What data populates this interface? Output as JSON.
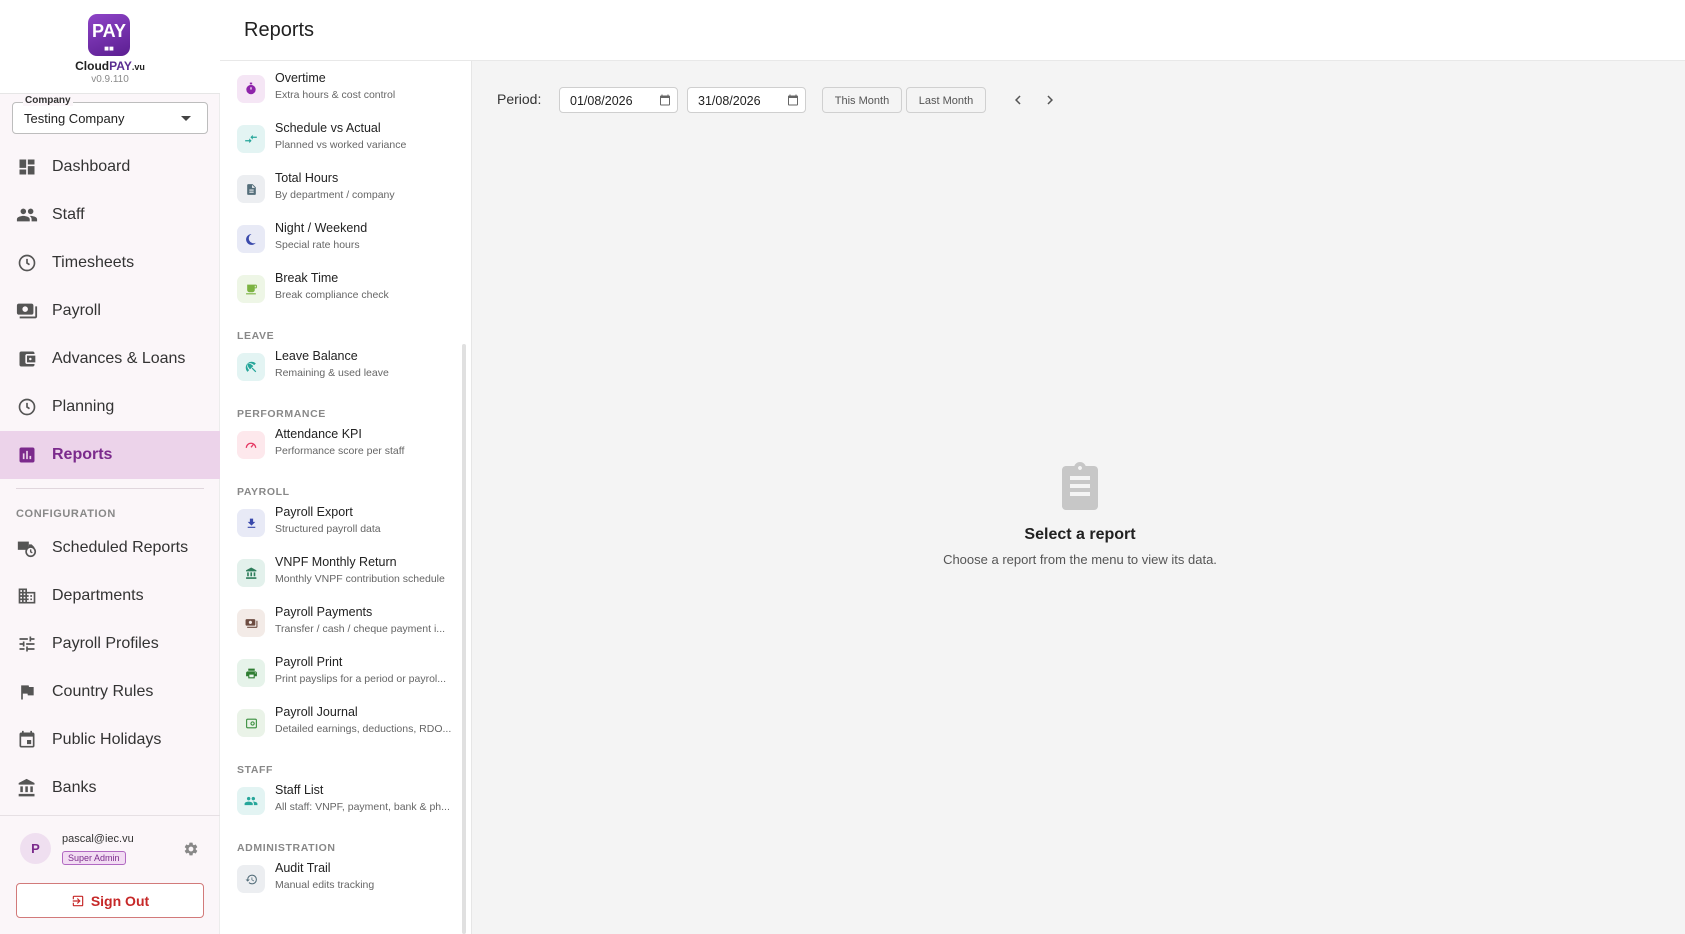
{
  "header": {
    "title": "Reports"
  },
  "brand": {
    "logo_text": "PAY",
    "name_part1": "Cloud",
    "name_part2": "PAY",
    "name_suffix": ".vu",
    "version": "v0.9.110"
  },
  "company": {
    "label": "Company",
    "value": "Testing Company"
  },
  "nav": {
    "items": [
      {
        "label": "Dashboard",
        "icon": "dashboard-icon"
      },
      {
        "label": "Staff",
        "icon": "people-icon"
      },
      {
        "label": "Timesheets",
        "icon": "clock-icon"
      },
      {
        "label": "Payroll",
        "icon": "payments-icon"
      },
      {
        "label": "Advances & Loans",
        "icon": "wallet-icon"
      },
      {
        "label": "Planning",
        "icon": "clock-icon"
      },
      {
        "label": "Reports",
        "icon": "bar-chart-icon",
        "active": true
      }
    ],
    "section_label": "CONFIGURATION",
    "config_items": [
      {
        "label": "Scheduled Reports",
        "icon": "truck-clock-icon"
      },
      {
        "label": "Departments",
        "icon": "building-icon"
      },
      {
        "label": "Payroll Profiles",
        "icon": "tune-icon"
      },
      {
        "label": "Country Rules",
        "icon": "flag-icon"
      },
      {
        "label": "Public Holidays",
        "icon": "calendar-icon"
      },
      {
        "label": "Banks",
        "icon": "bank-icon"
      }
    ]
  },
  "user": {
    "initial": "P",
    "email": "pascal@iec.vu",
    "role": "Super Admin",
    "signout_label": "Sign Out"
  },
  "report_menu": {
    "items_top": [
      {
        "title": "Overtime",
        "subtitle": "Extra hours & cost control",
        "icon": "stopwatch-icon"
      },
      {
        "title": "Schedule vs Actual",
        "subtitle": "Planned vs worked variance",
        "icon": "compare-arrows-icon"
      },
      {
        "title": "Total Hours",
        "subtitle": "By department / company",
        "icon": "document-icon"
      },
      {
        "title": "Night / Weekend",
        "subtitle": "Special rate hours",
        "icon": "moon-icon"
      },
      {
        "title": "Break Time",
        "subtitle": "Break compliance check",
        "icon": "coffee-icon"
      }
    ],
    "sections": {
      "leave": "LEAVE",
      "performance": "PERFORMANCE",
      "payroll": "PAYROLL",
      "staff": "STAFF",
      "administration": "ADMINISTRATION"
    },
    "leave_items": [
      {
        "title": "Leave Balance",
        "subtitle": "Remaining & used leave",
        "icon": "beach-umbrella-icon"
      }
    ],
    "performance_items": [
      {
        "title": "Attendance KPI",
        "subtitle": "Performance score per staff",
        "icon": "speedometer-icon"
      }
    ],
    "payroll_items": [
      {
        "title": "Payroll Export",
        "subtitle": "Structured payroll data",
        "icon": "download-icon"
      },
      {
        "title": "VNPF Monthly Return",
        "subtitle": "Monthly VNPF contribution schedule",
        "icon": "bank-icon"
      },
      {
        "title": "Payroll Payments",
        "subtitle": "Transfer / cash / cheque payment i...",
        "icon": "payments-icon"
      },
      {
        "title": "Payroll Print",
        "subtitle": "Print payslips for a period or payrol...",
        "icon": "printer-icon"
      },
      {
        "title": "Payroll Journal",
        "subtitle": "Detailed earnings, deductions, RDO...",
        "icon": "journal-icon"
      }
    ],
    "staff_items": [
      {
        "title": "Staff List",
        "subtitle": "All staff: VNPF, payment, bank & ph...",
        "icon": "people-icon"
      }
    ],
    "admin_items": [
      {
        "title": "Audit Trail",
        "subtitle": "Manual edits tracking",
        "icon": "history-icon"
      }
    ]
  },
  "filters": {
    "period_label": "Period:",
    "date_from": "01/08/2026",
    "date_to": "31/08/2026",
    "this_month": "This Month",
    "last_month": "Last Month"
  },
  "empty_state": {
    "title": "Select a report",
    "subtitle": "Choose a report from the menu to view its data."
  },
  "colors": {
    "brand": "#6a2a9e",
    "nav_active_bg": "#ecd3ea",
    "nav_active_text": "#7b2a8c",
    "signout": "#c62828"
  }
}
